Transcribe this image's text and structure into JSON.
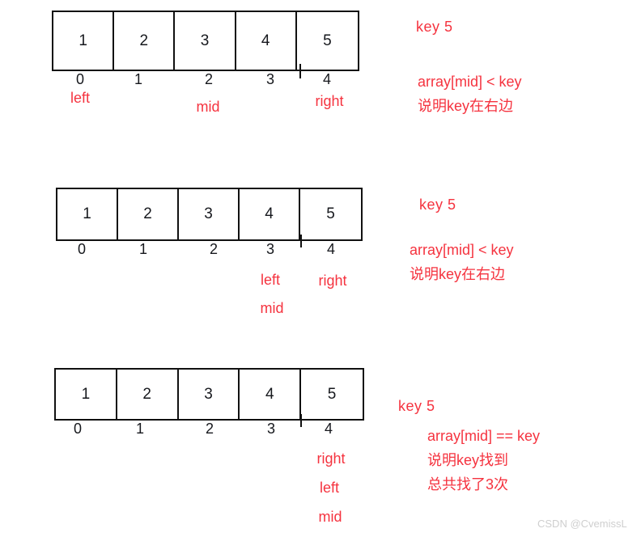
{
  "diagram": {
    "title_semantic": "binary-search-step-illustration",
    "accent_color": "#f5333f",
    "ink_color": "#16181d",
    "watermark": "CSDN @CvemissL",
    "array_values": [
      "1",
      "2",
      "3",
      "4",
      "5"
    ],
    "index_labels": [
      "0",
      "1",
      "2",
      "3",
      "4"
    ],
    "steps": [
      {
        "id": "step-1",
        "values": [
          "1",
          "2",
          "3",
          "4",
          "5"
        ],
        "indices": [
          "0",
          "1",
          "2",
          "3",
          "4"
        ],
        "pointers": [
          {
            "label": "left",
            "index": 0
          },
          {
            "label": "mid",
            "index": 2
          },
          {
            "label": "right",
            "index": 4
          }
        ],
        "notes": {
          "key": "key  5",
          "condition": "array[mid] < key",
          "conclusion": "说明key在右边"
        }
      },
      {
        "id": "step-2",
        "values": [
          "1",
          "2",
          "3",
          "4",
          "5"
        ],
        "indices": [
          "0",
          "1",
          "2",
          "3",
          "4"
        ],
        "pointers": [
          {
            "label": "left",
            "index": 3
          },
          {
            "label": "mid",
            "index": 3
          },
          {
            "label": "right",
            "index": 4
          }
        ],
        "notes": {
          "key": "key  5",
          "condition": "array[mid] < key",
          "conclusion": "说明key在右边"
        }
      },
      {
        "id": "step-3",
        "values": [
          "1",
          "2",
          "3",
          "4",
          "5"
        ],
        "indices": [
          "0",
          "1",
          "2",
          "3",
          "4"
        ],
        "pointers": [
          {
            "label": "right",
            "index": 4
          },
          {
            "label": "left",
            "index": 4
          },
          {
            "label": "mid",
            "index": 4
          }
        ],
        "notes": {
          "key": "key  5",
          "condition": "array[mid] == key",
          "conclusion": "说明key找到",
          "summary": "总共找了3次"
        }
      }
    ]
  }
}
